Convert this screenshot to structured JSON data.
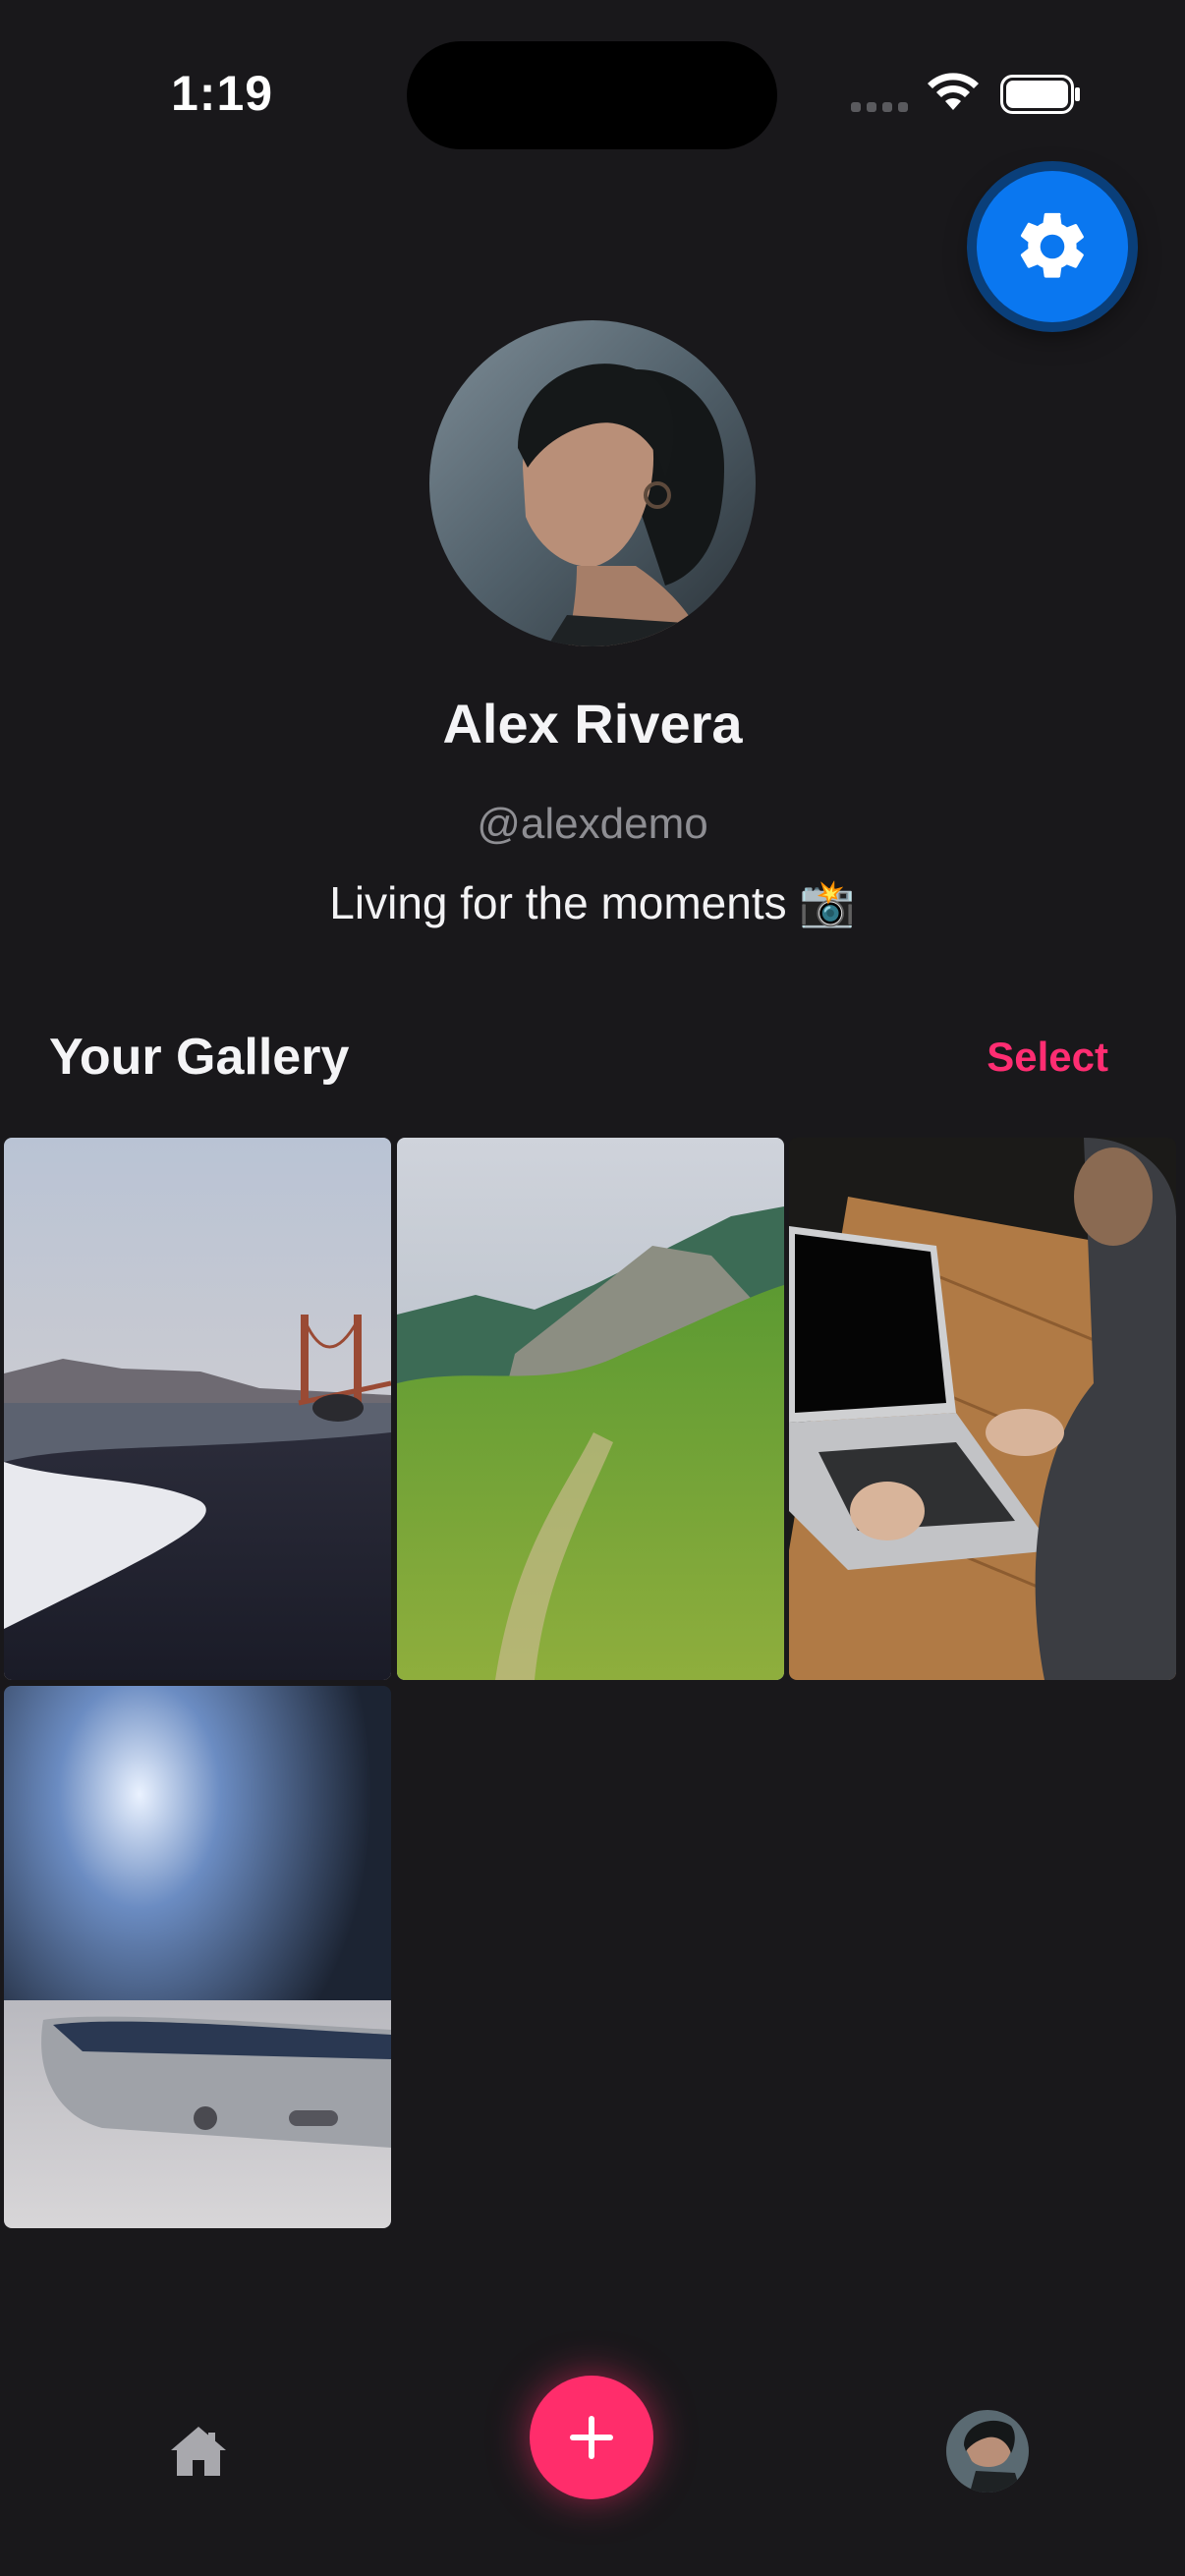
{
  "status_bar": {
    "time": "1:19"
  },
  "profile": {
    "name": "Alex Rivera",
    "handle": "@alexdemo",
    "bio": "Living for the moments 📸"
  },
  "gallery": {
    "title": "Your Gallery",
    "select_label": "Select",
    "photos": [
      "beach-golden-gate",
      "green-mountain-trail",
      "person-laptop",
      "smartphone-closeup"
    ]
  },
  "icons": {
    "settings": "gear-icon",
    "home": "house-icon",
    "add": "plus-icon",
    "profile": "avatar-icon"
  },
  "colors": {
    "background": "#19181b",
    "accent_pink": "#ff2d6b",
    "settings_blue": "#0a77f0"
  }
}
